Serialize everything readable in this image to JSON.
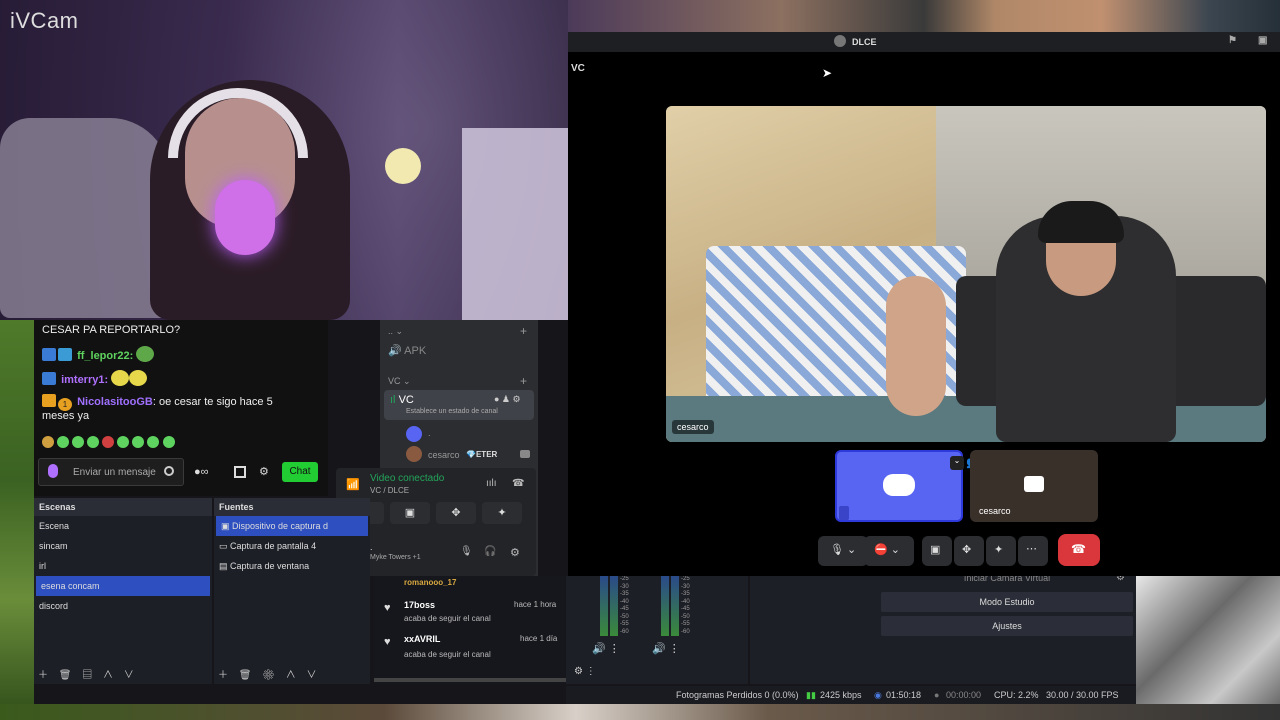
{
  "webcam": {
    "overlay_label": "iVCam"
  },
  "chat": {
    "lines": [
      {
        "text": "CESAR PA REPORTARLO?"
      },
      {
        "user": "ff_lepor22:",
        "text": ""
      },
      {
        "user": "imterry1:",
        "text": ""
      },
      {
        "user": "NicolasitooGB",
        "text": ": oe cesar te sigo hace 5"
      },
      {
        "text": "meses ya"
      }
    ],
    "badge_count": "1",
    "input_placeholder": "Enviar un mensaje",
    "chat_button": "Chat"
  },
  "discord": {
    "title": "DLCE",
    "channel_header": "VC",
    "sidebar": {
      "voice_channel_apk": "APK",
      "category_vc": "VC",
      "active_channel": "VC",
      "status_placeholder": "Establece un estado de canal",
      "member_dot": ".",
      "member_name": "cesarco",
      "member_badge": "ETER"
    },
    "voice_panel": {
      "status": "Video conectado",
      "subtitle": "VC / DLCE",
      "user": ".",
      "activity": "Myke Towers +1"
    },
    "participants": [
      {
        "name": "cesarco"
      },
      {
        "name": "cesarco"
      }
    ]
  },
  "obs": {
    "scenes_title": "Escenas",
    "scenes": [
      "Escena",
      "sincam",
      "irl",
      "esena concam",
      "discord"
    ],
    "selected_scene": 3,
    "sources_title": "Fuentes",
    "sources": [
      "Dispositivo de captura d",
      "Captura de pantalla 4",
      "Captura de ventana"
    ],
    "alerts": [
      {
        "name": "romanooo_17",
        "action": "",
        "time": ""
      },
      {
        "name": "17boss",
        "action": "acaba de seguir el canal",
        "time": "hace 1 hora"
      },
      {
        "name": "xxAVRIL",
        "action": "acaba de seguir el canal",
        "time": "hace 1 día"
      }
    ],
    "meter_labels": [
      "-25",
      "-30",
      "-35",
      "-40",
      "-45",
      "-50",
      "-55",
      "-60"
    ],
    "controls": [
      "Iniciar Cámara Virtual",
      "Modo Estudio",
      "Ajustes"
    ],
    "status": {
      "dropped": "Fotogramas Perdidos 0 (0.0%)",
      "bitrate": "2425 kbps",
      "live_time": "01:50:18",
      "rec_time": "00:00:00",
      "cpu": "CPU: 2.2%",
      "fps": "30.00 / 30.00 FPS"
    }
  },
  "colors": {
    "discord_blurple": "#5865f2",
    "chat_green": "#22cc33",
    "obs_select": "#2d4fbf",
    "hangup": "#da373c"
  }
}
